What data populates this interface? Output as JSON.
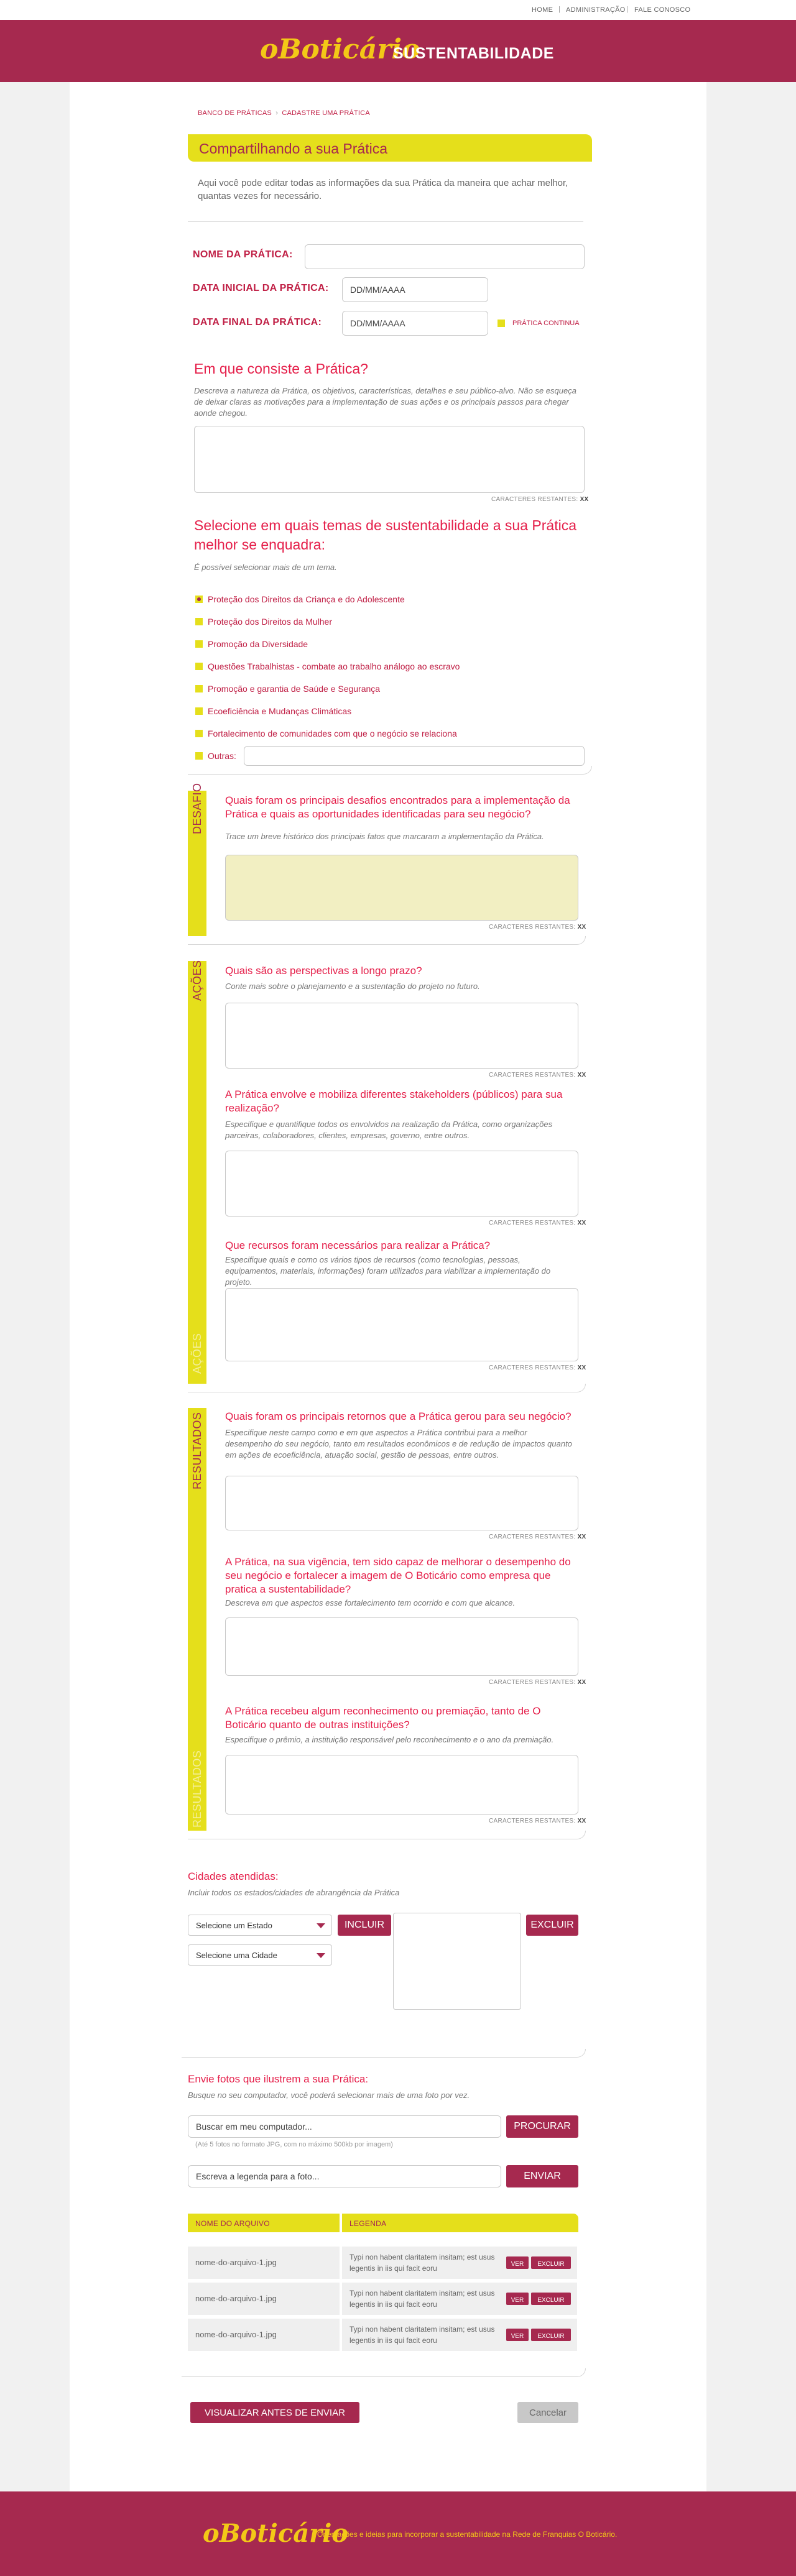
{
  "topnav": [
    "HOME",
    "ADMINISTRAÇÃO",
    "FALE CONOSCO"
  ],
  "header": {
    "logo": "oBoticário",
    "title": "SUSTENTABILIDADE"
  },
  "breadcrumb": {
    "parent": "BANCO DE PRÁTICAS",
    "separator": "›",
    "current": "CADASTRE UMA PRÁTICA"
  },
  "banner": "Compartilhando a sua Prática",
  "intro": "Aqui você pode editar todas as informações da sua Prática da maneira que achar melhor, quantas vezes for necessário.",
  "fields": {
    "name_label": "NOME DA PRÁTICA:",
    "start_label": "DATA INICIAL DA PRÁTICA:",
    "start_placeholder": "DD/MM/AAAA",
    "end_label": "DATA FINAL DA PRÁTICA:",
    "end_placeholder": "DD/MM/AAAA",
    "continuous": "PRÁTICA CONTINUA"
  },
  "counter_label": "CARACTERES RESTANTES:",
  "counter_value": "XX",
  "consiste": {
    "title": "Em que consiste a Prática?",
    "desc": "Descreva a natureza da Prática, os objetivos, características, detalhes e seu público-alvo. Não se esqueça de deixar claras as motivações para a implementação de suas ações e os principais passos para chegar aonde chegou."
  },
  "temas": {
    "title": "Selecione em quais temas de sustentabilidade a sua Prática melhor se enquadra:",
    "desc": "É possível selecionar mais de um tema.",
    "options": [
      "Proteção dos Direitos da Criança e do Adolescente",
      "Proteção dos Direitos da Mulher",
      "Promoção da Diversidade",
      "Questões Trabalhistas - combate ao trabalho análogo ao escravo",
      "Promoção e garantia de Saúde e Segurança",
      "Ecoeficiência e Mudanças Climáticas",
      "Fortalecimento de comunidades com que o negócio se relaciona"
    ],
    "other": "Outras:"
  },
  "desafio": {
    "label": "DESAFIO",
    "q1": "Quais foram os principais desafios encontrados para a implementação da Prática e quais as oportunidades identificadas para seu negócio?",
    "d1": "Trace um breve histórico dos principais fatos que marcaram a implementação da Prática."
  },
  "acoes": {
    "label": "AÇÕES",
    "q1": "Quais são as perspectivas a longo prazo?",
    "d1": "Conte mais sobre o planejamento e a sustentação do projeto no futuro.",
    "q2": "A Prática envolve e mobiliza diferentes stakeholders (públicos) para sua realização?",
    "d2": "Especifique e quantifique todos os envolvidos na realização da Prática, como organizações parceiras, colaboradores, clientes, empresas, governo, entre outros.",
    "q3": "Que recursos foram necessários para realizar a Prática?",
    "d3": "Especifique quais e como os vários tipos de recursos (como tecnologias, pessoas, equipamentos, materiais, informações) foram utilizados para viabilizar a implementação do projeto."
  },
  "resultados": {
    "label": "RESULTADOS",
    "q1": "Quais foram os principais retornos que a Prática gerou para seu negócio?",
    "d1": "Especifique neste campo como e em que aspectos a Prática contribui para a melhor desempenho do seu negócio, tanto em resultados econômicos e de redução de impactos quanto em ações de ecoeficiência, atuação social, gestão de pessoas, entre outros.",
    "q2": "A Prática, na sua vigência, tem sido capaz de melhorar o desempenho do seu negócio e fortalecer a imagem de O Boticário como empresa que pratica a sustentabilidade?",
    "d2": "Descreva em que aspectos esse fortalecimento tem ocorrido e com que alcance.",
    "q3": "A Prática recebeu algum reconhecimento ou premiação, tanto de O Boticário quanto de outras instituições?",
    "d3": "Especifique o prêmio, a instituição responsável pelo reconhecimento e o ano da premiação."
  },
  "cidades": {
    "title": "Cidades atendidas:",
    "desc": "Incluir todos os estados/cidades de abrangência da Prática",
    "state": "Selecione um Estado",
    "city": "Selecione uma Cidade",
    "include": "INCLUIR",
    "remove": "EXCLUIR"
  },
  "fotos": {
    "title": "Envie fotos que ilustrem a sua Prática:",
    "desc": "Busque no seu computador, você poderá selecionar mais de uma foto por vez.",
    "file_placeholder": "Buscar em meu computador...",
    "browse": "PROCURAR",
    "hint": "(Até 5 fotos no formato JPG, com no máximo 500kb por imagem)",
    "caption_placeholder": "Escreva a legenda para a foto...",
    "send": "ENVIAR",
    "col_file": "NOME DO ARQUIVO",
    "col_caption": "LEGENDA",
    "rows": [
      {
        "file": "nome-do-arquivo-1.jpg",
        "caption": "Typi non habent claritatem insitam; est usus legentis in iis qui facit eoru"
      },
      {
        "file": "nome-do-arquivo-1.jpg",
        "caption": "Typi non habent claritatem insitam; est usus legentis in iis qui facit eoru"
      },
      {
        "file": "nome-do-arquivo-1.jpg",
        "caption": "Typi non habent claritatem insitam; est usus legentis in iis qui facit eoru"
      }
    ],
    "view": "VER",
    "delete": "EXCLUIR"
  },
  "actions": {
    "preview": "VISUALIZAR ANTES DE ENVIAR",
    "cancel": "Cancelar"
  },
  "footer": {
    "logo": "oBoticário",
    "tagline": "Orientações e ideias para incorporar a sustentabilidade na Rede de Franquias O Boticário."
  },
  "colors": {
    "primary": "#a6294f",
    "accent": "#e5df1b",
    "heading": "#e51f4a"
  }
}
